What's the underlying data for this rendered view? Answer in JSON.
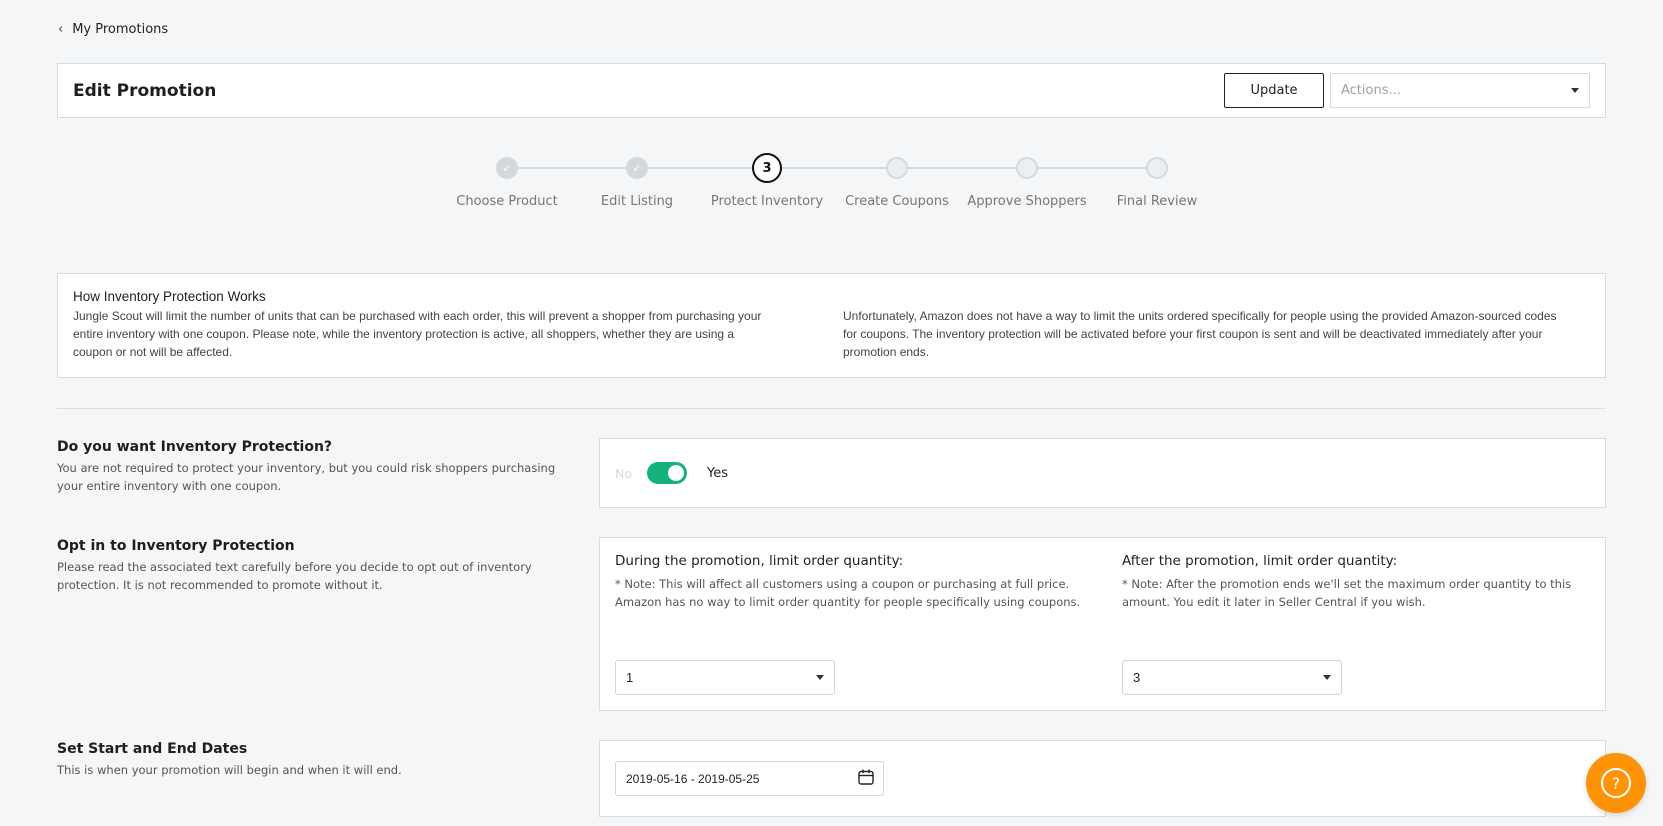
{
  "nav": {
    "back_label": "My Promotions"
  },
  "header": {
    "title": "Edit Promotion",
    "update_label": "Update",
    "actions_placeholder": "Actions..."
  },
  "stepper": {
    "current_step": 3,
    "steps": [
      {
        "label": "Choose Product",
        "state": "done"
      },
      {
        "label": "Edit Listing",
        "state": "done"
      },
      {
        "label": "Protect Inventory",
        "state": "current",
        "number": "3"
      },
      {
        "label": "Create Coupons",
        "state": "upcoming"
      },
      {
        "label": "Approve Shoppers",
        "state": "upcoming"
      },
      {
        "label": "Final Review",
        "state": "upcoming"
      }
    ]
  },
  "info": {
    "title": "How Inventory Protection Works",
    "left_text": "Jungle Scout will limit the number of units that can be purchased with each order, this will prevent a shopper from purchasing your entire inventory with one coupon. Please note, while the inventory protection is active, all shoppers, whether they are using a coupon or not will be affected.",
    "right_text": "Unfortunately, Amazon does not have a way to limit the units ordered specifically for people using the provided Amazon-sourced codes for coupons. The inventory protection will be activated before your first coupon is sent and will be deactivated immediately after your promotion ends."
  },
  "protection": {
    "title": "Do you want Inventory Protection?",
    "description": "You are not required to protect your inventory, but you could risk shoppers purchasing your entire inventory with one coupon.",
    "toggle_off_label": "No",
    "toggle_on_label": "Yes",
    "enabled": true,
    "toggle_color": "#14b17a"
  },
  "opt_in": {
    "title": "Opt in to Inventory Protection",
    "description": "Please read the associated text carefully before you decide to opt out of inventory protection. It is not recommended to promote without it.",
    "during": {
      "title": "During the promotion, limit order quantity:",
      "note": "* Note: This will affect all customers using a coupon or purchasing at full price. Amazon has no way to limit order quantity for people specifically using coupons.",
      "value": "1"
    },
    "after": {
      "title": "After the promotion, limit order quantity:",
      "note": "* Note: After the promotion ends we'll set the maximum order quantity to this amount. You edit it later in Seller Central if you wish.",
      "value": "3"
    }
  },
  "dates": {
    "title": "Set Start and End Dates",
    "description": "This is when your promotion will begin and when it will end.",
    "range": "2019-05-16 - 2019-05-25",
    "icon": "calendar-icon"
  },
  "help": {
    "icon": "help-question-icon",
    "color": "#ff9308"
  }
}
